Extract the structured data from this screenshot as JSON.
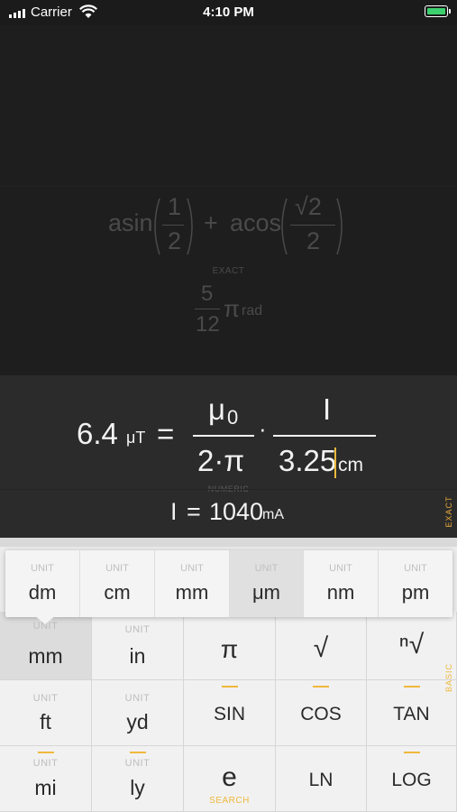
{
  "status_bar": {
    "carrier": "Carrier",
    "time": "4:10 PM"
  },
  "history": {
    "expr_asin": "asin",
    "expr_plus": "+",
    "expr_acos": "acos",
    "frac1_num": "1",
    "frac1_den": "2",
    "frac2_num": "√2",
    "frac2_den": "2",
    "mode_label": "EXACT",
    "result_num": "5",
    "result_den": "12",
    "result_pi": "π",
    "result_unit": "rad"
  },
  "current": {
    "lhs_value": "6.4",
    "lhs_unit": "μT",
    "equals": "=",
    "mu": "μ",
    "mu_sub": "0",
    "den_left": "2·π",
    "dot": "·",
    "num_right": "I",
    "den_value": "3.25",
    "den_unit": "cm",
    "mode_label": "NUMERIC",
    "result_var": "I",
    "result_eq": "=",
    "result_value": "1040",
    "result_unit": "mA",
    "side_tab": "EXACT"
  },
  "popup": {
    "items": [
      {
        "up": "UNIT",
        "label": "dm"
      },
      {
        "up": "UNIT",
        "label": "cm"
      },
      {
        "up": "UNIT",
        "label": "mm"
      },
      {
        "up": "UNIT",
        "label": "μm"
      },
      {
        "up": "UNIT",
        "label": "nm"
      },
      {
        "up": "UNIT",
        "label": "pm"
      }
    ]
  },
  "keypad": {
    "side_tab": "BASIC",
    "row1": [
      {
        "up": "UNIT",
        "label": "mm"
      },
      {
        "up": "UNIT",
        "label": "in"
      },
      {
        "up": "",
        "label": "π"
      },
      {
        "up": "",
        "label": "√"
      },
      {
        "up": "",
        "label": "ⁿ√"
      }
    ],
    "row2": [
      {
        "up": "UNIT",
        "label": "ft"
      },
      {
        "up": "UNIT",
        "label": "yd"
      },
      {
        "up": "",
        "label": "SIN"
      },
      {
        "up": "",
        "label": "COS"
      },
      {
        "up": "",
        "label": "TAN"
      }
    ],
    "row3": [
      {
        "up": "UNIT",
        "label": "mi"
      },
      {
        "up": "UNIT",
        "label": "ly"
      },
      {
        "up": "",
        "label": "e",
        "down": "SEARCH"
      },
      {
        "up": "",
        "label": "LN"
      },
      {
        "up": "",
        "label": "LOG"
      }
    ]
  },
  "colors": {
    "accent": "#f0b83b",
    "battery": "#3dd06e"
  }
}
